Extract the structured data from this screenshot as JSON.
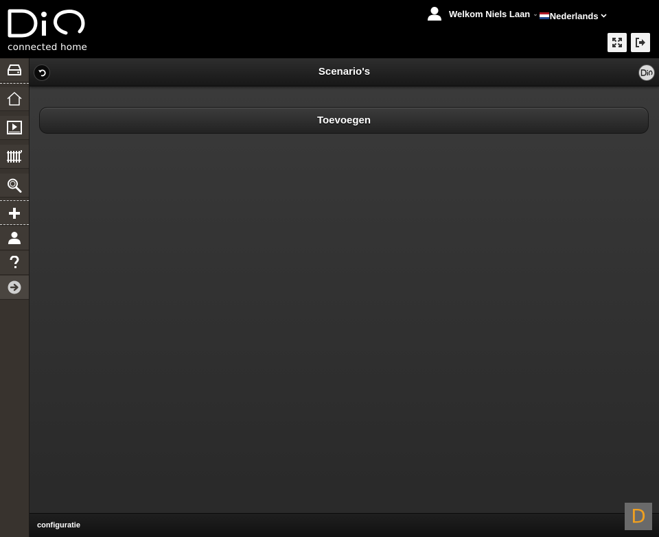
{
  "header": {
    "logo_text": "DiO",
    "logo_tagline": "connected home",
    "welcome": "Welkom Niels Laan",
    "language": "Nederlands",
    "flag_colors": [
      "#ae1c28",
      "#ffffff",
      "#21468b"
    ],
    "icons": {
      "user": "user-icon",
      "fullscreen": "expand-icon",
      "logout": "logout-icon"
    }
  },
  "sidebar": {
    "items": [
      {
        "name": "sidebar-item-devices",
        "icon": "device-icon"
      },
      {
        "name": "sidebar-item-home",
        "icon": "house-icon"
      },
      {
        "name": "sidebar-item-media",
        "icon": "media-player-icon"
      },
      {
        "name": "sidebar-item-heating",
        "icon": "radiator-icon"
      },
      {
        "name": "sidebar-item-search",
        "icon": "magnifier-icon"
      },
      {
        "name": "sidebar-item-add",
        "icon": "plus-icon"
      },
      {
        "name": "sidebar-item-account",
        "icon": "user-icon"
      },
      {
        "name": "sidebar-item-help",
        "icon": "question-icon"
      },
      {
        "name": "sidebar-item-forward",
        "icon": "arrow-right-circle-icon"
      }
    ]
  },
  "main": {
    "title": "Scenario's",
    "add_label": "Toevoegen",
    "footer_label": "configuratie"
  },
  "badge": {
    "letter": "D",
    "color": "#f0a020"
  },
  "colors": {
    "header_bg": "#000000",
    "sidebar_bg": "#38332e",
    "content_bg": "#333333"
  }
}
